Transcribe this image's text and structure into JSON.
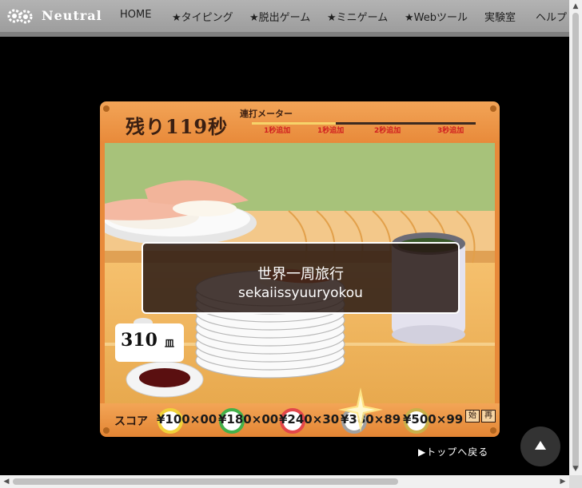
{
  "site": {
    "logo_text": "Neutral",
    "nav": [
      "HOME",
      "★タイピング",
      "★脱出ゲーム",
      "★ミニゲーム",
      "★Webツール",
      "実験室",
      "ヘルプ"
    ]
  },
  "game": {
    "timer": "残り119秒",
    "meter_title": "連打メーター",
    "meter_labels": [
      "1秒追加",
      "1秒追加",
      "2秒追加",
      "3秒追加"
    ],
    "word_japanese": "世界一周旅行",
    "word_romaji": "sekaiissyuuryokou",
    "dish_count": "310",
    "dish_unit": "皿",
    "score_label": "スコア",
    "plates": [
      {
        "price": "¥100",
        "count": "×00",
        "color": "#f0d23a"
      },
      {
        "price": "¥180",
        "count": "×00",
        "color": "#43b04a"
      },
      {
        "price": "¥240",
        "count": "×30",
        "color": "#e2464a"
      },
      {
        "price": "¥380",
        "count": "×89",
        "color": "#a0a0a0"
      },
      {
        "price": "¥500",
        "count": "×99",
        "color": "#c9b04a"
      }
    ],
    "buttons": [
      "始",
      "再"
    ]
  },
  "footer": {
    "back_link": "▶トップへ戻る"
  },
  "colors": {
    "nav_bg": "#a6a6a6",
    "wood": "#e88a3a",
    "wall": "#a7c27a",
    "meter_fill": "#f6d36a"
  }
}
